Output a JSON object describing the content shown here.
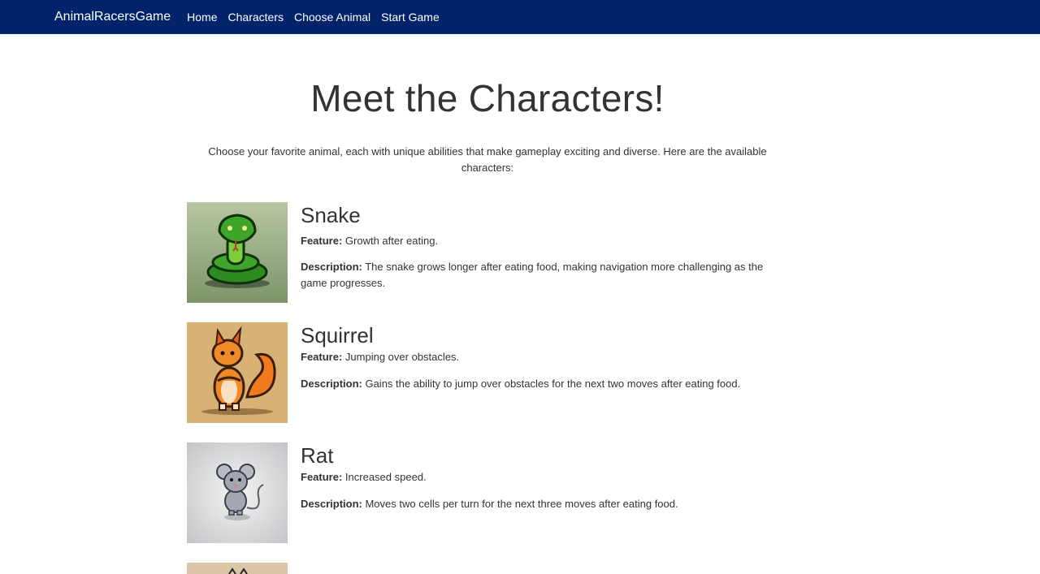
{
  "navbar": {
    "brand": "AnimalRacersGame",
    "links": [
      "Home",
      "Characters",
      "Choose Animal",
      "Start Game"
    ]
  },
  "page": {
    "title": "Meet the Characters!",
    "intro": "Choose your favorite animal, each with unique abilities that make gameplay exciting and diverse. Here are the available characters:"
  },
  "labels": {
    "feature": "Feature:",
    "description": "Description:"
  },
  "characters": [
    {
      "name": "Snake",
      "feature": "Growth after eating.",
      "description": "The snake grows longer after eating food, making navigation more challenging as the game progresses.",
      "image": "snake-illustration"
    },
    {
      "name": "Squirrel",
      "feature": "Jumping over obstacles.",
      "description": "Gains the ability to jump over obstacles for the next two moves after eating food.",
      "image": "squirrel-illustration"
    },
    {
      "name": "Rat",
      "feature": "Increased speed.",
      "description": "Moves two cells per turn for the next three moves after eating food.",
      "image": "rat-illustration"
    }
  ],
  "colors": {
    "navbar": "#00236a",
    "text": "#333333"
  }
}
